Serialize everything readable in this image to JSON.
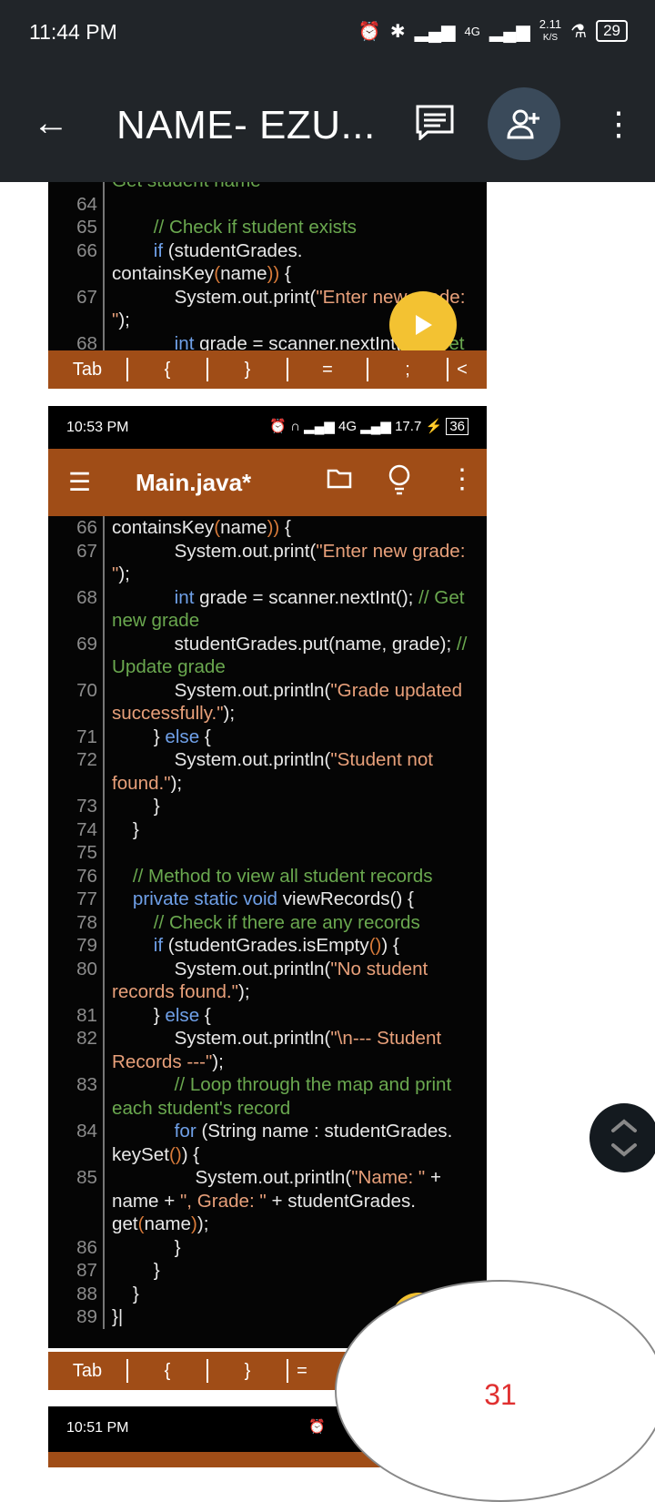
{
  "status_bar": {
    "time": "11:44 PM",
    "battery": "29",
    "net_speed": "2.11",
    "net_unit": "K/S",
    "network": "4G"
  },
  "app_bar": {
    "title": "NAME- EZU...",
    "icons": [
      "back-arrow-icon",
      "comment-icon",
      "add-person-icon",
      "more-vert-icon"
    ]
  },
  "screenshot1": {
    "lines": [
      {
        "n": "",
        "segs": [
          {
            "t": "Get student name",
            "c": "cm"
          }
        ]
      },
      {
        "n": "64",
        "segs": []
      },
      {
        "n": "65",
        "segs": [
          {
            "t": "        // Check if student exists",
            "c": "cm"
          }
        ]
      },
      {
        "n": "66",
        "segs": [
          {
            "t": "        ",
            "c": ""
          },
          {
            "t": "if",
            "c": "kw"
          },
          {
            "t": " (studentGrades.",
            "c": ""
          }
        ]
      },
      {
        "n": "",
        "segs": [
          {
            "t": "containsKey",
            "c": ""
          },
          {
            "t": "(",
            "c": "br"
          },
          {
            "t": "name",
            "c": ""
          },
          {
            "t": "))",
            "c": "br"
          },
          {
            "t": " {",
            "c": ""
          }
        ]
      },
      {
        "n": "67",
        "segs": [
          {
            "t": "            System.out.print(",
            "c": ""
          },
          {
            "t": "\"Enter new grade:",
            "c": "str"
          }
        ]
      },
      {
        "n": "",
        "segs": [
          {
            "t": "\"",
            "c": "str"
          },
          {
            "t": ");",
            "c": ""
          }
        ]
      },
      {
        "n": "68",
        "segs": [
          {
            "t": "            ",
            "c": ""
          },
          {
            "t": "int",
            "c": "kw"
          },
          {
            "t": " grade = scanner.nextInt(); ",
            "c": ""
          },
          {
            "t": "// Get",
            "c": "cm"
          }
        ]
      }
    ],
    "tabbar": [
      "Tab",
      "{",
      "}",
      "=",
      ";",
      "<"
    ]
  },
  "screenshot2": {
    "status": {
      "time": "10:53 PM",
      "battery": "36",
      "speed": "17.7"
    },
    "editor_title": "Main.java*",
    "lines": [
      {
        "n": "66",
        "segs": [
          {
            "t": "containsKey",
            "c": ""
          },
          {
            "t": "(",
            "c": "br"
          },
          {
            "t": "name",
            "c": ""
          },
          {
            "t": "))",
            "c": "br"
          },
          {
            "t": " {",
            "c": ""
          }
        ]
      },
      {
        "n": "67",
        "segs": [
          {
            "t": "            System.out.print(",
            "c": ""
          },
          {
            "t": "\"Enter new grade:",
            "c": "str"
          }
        ]
      },
      {
        "n": "",
        "segs": [
          {
            "t": "\"",
            "c": "str"
          },
          {
            "t": ");",
            "c": ""
          }
        ]
      },
      {
        "n": "68",
        "segs": [
          {
            "t": "            ",
            "c": ""
          },
          {
            "t": "int",
            "c": "kw"
          },
          {
            "t": " grade = scanner.nextInt(); ",
            "c": ""
          },
          {
            "t": "// Get",
            "c": "cm"
          }
        ]
      },
      {
        "n": "",
        "segs": [
          {
            "t": "new grade",
            "c": "cm"
          }
        ]
      },
      {
        "n": "69",
        "segs": [
          {
            "t": "            studentGrades.put(name, grade); ",
            "c": ""
          },
          {
            "t": "//",
            "c": "cm"
          }
        ]
      },
      {
        "n": "",
        "segs": [
          {
            "t": "Update grade",
            "c": "cm"
          }
        ]
      },
      {
        "n": "70",
        "segs": [
          {
            "t": "            System.out.println(",
            "c": ""
          },
          {
            "t": "\"Grade updated",
            "c": "str"
          }
        ]
      },
      {
        "n": "",
        "segs": [
          {
            "t": "successfully.\"",
            "c": "str"
          },
          {
            "t": ");",
            "c": ""
          }
        ]
      },
      {
        "n": "71",
        "segs": [
          {
            "t": "        } ",
            "c": ""
          },
          {
            "t": "else",
            "c": "kw"
          },
          {
            "t": " {",
            "c": ""
          }
        ]
      },
      {
        "n": "72",
        "segs": [
          {
            "t": "            System.out.println(",
            "c": ""
          },
          {
            "t": "\"Student not",
            "c": "str"
          }
        ]
      },
      {
        "n": "",
        "segs": [
          {
            "t": "found.\"",
            "c": "str"
          },
          {
            "t": ");",
            "c": ""
          }
        ]
      },
      {
        "n": "73",
        "segs": [
          {
            "t": "        }",
            "c": ""
          }
        ]
      },
      {
        "n": "74",
        "segs": [
          {
            "t": "    }",
            "c": ""
          }
        ]
      },
      {
        "n": "75",
        "segs": []
      },
      {
        "n": "76",
        "segs": [
          {
            "t": "    // Method to view all student records",
            "c": "cm"
          }
        ]
      },
      {
        "n": "77",
        "segs": [
          {
            "t": "    ",
            "c": ""
          },
          {
            "t": "private static void",
            "c": "kw"
          },
          {
            "t": " viewRecords() {",
            "c": ""
          }
        ]
      },
      {
        "n": "78",
        "segs": [
          {
            "t": "        // Check if there are any records",
            "c": "cm"
          }
        ]
      },
      {
        "n": "79",
        "segs": [
          {
            "t": "        ",
            "c": ""
          },
          {
            "t": "if",
            "c": "kw"
          },
          {
            "t": " (studentGrades.isEmpty",
            "c": ""
          },
          {
            "t": "()",
            "c": "br"
          },
          {
            "t": ") {",
            "c": ""
          }
        ]
      },
      {
        "n": "80",
        "segs": [
          {
            "t": "            System.out.println(",
            "c": ""
          },
          {
            "t": "\"No student",
            "c": "str"
          }
        ]
      },
      {
        "n": "",
        "segs": [
          {
            "t": "records found.\"",
            "c": "str"
          },
          {
            "t": ");",
            "c": ""
          }
        ]
      },
      {
        "n": "81",
        "segs": [
          {
            "t": "        } ",
            "c": ""
          },
          {
            "t": "else",
            "c": "kw"
          },
          {
            "t": " {",
            "c": ""
          }
        ]
      },
      {
        "n": "82",
        "segs": [
          {
            "t": "            System.out.println(",
            "c": ""
          },
          {
            "t": "\"\\n--- Student",
            "c": "str"
          }
        ]
      },
      {
        "n": "",
        "segs": [
          {
            "t": "Records ---\"",
            "c": "str"
          },
          {
            "t": ");",
            "c": ""
          }
        ]
      },
      {
        "n": "83",
        "segs": [
          {
            "t": "            // Loop through the map and print",
            "c": "cm"
          }
        ]
      },
      {
        "n": "",
        "segs": [
          {
            "t": "each student's record",
            "c": "cm"
          }
        ]
      },
      {
        "n": "84",
        "segs": [
          {
            "t": "            ",
            "c": ""
          },
          {
            "t": "for",
            "c": "kw"
          },
          {
            "t": " (String name : studentGrades.",
            "c": ""
          }
        ]
      },
      {
        "n": "",
        "segs": [
          {
            "t": "keySet",
            "c": ""
          },
          {
            "t": "()",
            "c": "br"
          },
          {
            "t": ") {",
            "c": ""
          }
        ]
      },
      {
        "n": "85",
        "segs": [
          {
            "t": "                System.out.println(",
            "c": ""
          },
          {
            "t": "\"Name: \"",
            "c": "str"
          },
          {
            "t": " +",
            "c": ""
          }
        ]
      },
      {
        "n": "",
        "segs": [
          {
            "t": "name + ",
            "c": ""
          },
          {
            "t": "\", Grade: \"",
            "c": "str"
          },
          {
            "t": " + studentGrades.",
            "c": ""
          }
        ]
      },
      {
        "n": "",
        "segs": [
          {
            "t": "get",
            "c": ""
          },
          {
            "t": "(",
            "c": "br"
          },
          {
            "t": "name",
            "c": ""
          },
          {
            "t": ")",
            "c": "br"
          },
          {
            "t": ");",
            "c": ""
          }
        ]
      },
      {
        "n": "86",
        "segs": [
          {
            "t": "            }",
            "c": ""
          }
        ]
      },
      {
        "n": "87",
        "segs": [
          {
            "t": "        }",
            "c": ""
          }
        ]
      },
      {
        "n": "88",
        "segs": [
          {
            "t": "    }",
            "c": ""
          }
        ]
      },
      {
        "n": "89",
        "segs": [
          {
            "t": "}|",
            "c": ""
          }
        ]
      }
    ],
    "tabbar": [
      "Tab",
      "{",
      "}",
      "="
    ]
  },
  "screenshot3": {
    "time": "10:51 PM"
  },
  "page_bubble": {
    "number": "31"
  }
}
